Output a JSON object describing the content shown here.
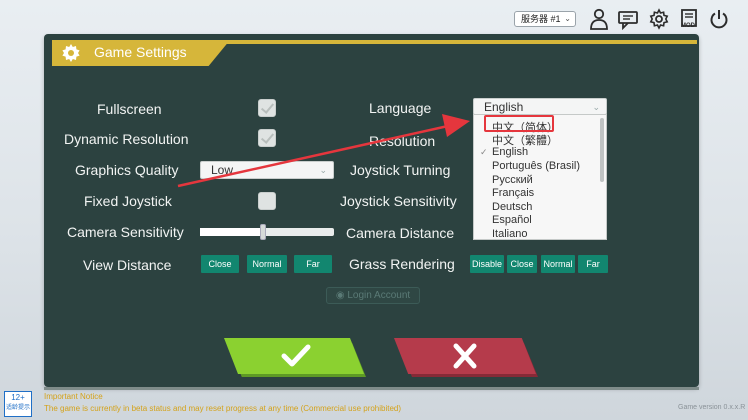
{
  "topbar": {
    "server_label": "服务器 #1",
    "server_caret": "⌄",
    "icons": [
      "person-icon",
      "chat-icon",
      "gear-icon",
      "mod-icon",
      "power-icon"
    ],
    "mod_label": "MOD"
  },
  "panel": {
    "title": "Game Settings",
    "accent_color": "#d6b63a",
    "background_color": "#2c4240"
  },
  "left_settings": {
    "fullscreen": {
      "label": "Fullscreen",
      "checked": true
    },
    "dynamic_resolution": {
      "label": "Dynamic Resolution",
      "checked": true
    },
    "graphics_quality": {
      "label": "Graphics Quality",
      "value": "Low"
    },
    "fixed_joystick": {
      "label": "Fixed Joystick",
      "checked": false
    },
    "camera_sensitivity": {
      "label": "Camera Sensitivity",
      "level": 0.47
    },
    "view_distance": {
      "label": "View Distance",
      "options": [
        "Close",
        "Normal",
        "Far"
      ]
    }
  },
  "right_settings": {
    "language": {
      "label": "Language",
      "value": "English"
    },
    "resolution": {
      "label": "Resolution"
    },
    "joystick_turning": {
      "label": "Joystick Turning"
    },
    "joystick_sensitivity": {
      "label": "Joystick Sensitivity"
    },
    "camera_distance": {
      "label": "Camera Distance"
    },
    "grass_rendering": {
      "label": "Grass Rendering",
      "options": [
        "Disable",
        "Close",
        "Normal",
        "Far"
      ]
    }
  },
  "language_dropdown": {
    "items": [
      "中文（简体）",
      "中文（繁體）",
      "English",
      "Português (Brasil)",
      "Русский",
      "Français",
      "Deutsch",
      "Español",
      "Italiano"
    ],
    "selected": "English",
    "highlighted": "中文（简体）"
  },
  "login_account": "Login Account",
  "footer": {
    "age_badge_line1": "12+",
    "age_badge_line2": "适龄提示",
    "warning_title": "Important Notice",
    "warning_text": "The game is currently in beta status and may reset progress at any time (Commercial use prohibited)",
    "version": "Game version 0.x.x.R"
  }
}
